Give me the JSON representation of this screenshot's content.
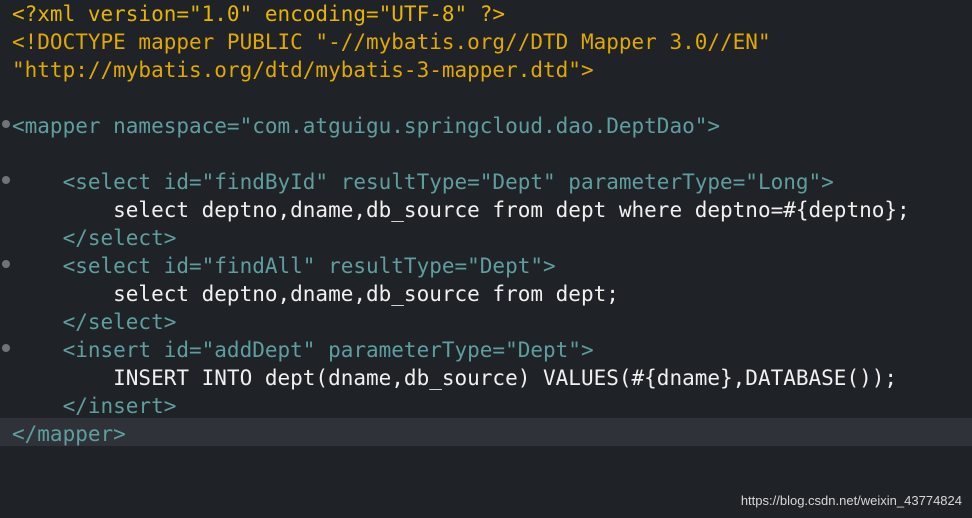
{
  "lines": [
    "<?xml version=\"1.0\" encoding=\"UTF-8\" ?>",
    "<!DOCTYPE mapper PUBLIC \"-//mybatis.org//DTD Mapper 3.0//EN\"",
    "\"http://mybatis.org/dtd/mybatis-3-mapper.dtd\">",
    "",
    "<mapper namespace=\"com.atguigu.springcloud.dao.DeptDao\">",
    "",
    "    <select id=\"findById\" resultType=\"Dept\" parameterType=\"Long\">",
    "        select deptno,dname,db_source from dept where deptno=#{deptno};",
    "    </select>",
    "    <select id=\"findAll\" resultType=\"Dept\">",
    "        select deptno,dname,db_source from dept;",
    "    </select>",
    "    <insert id=\"addDept\" parameterType=\"Dept\">",
    "        INSERT INTO dept(dname,db_source) VALUES(#{dname},DATABASE());",
    "    </insert>",
    "</mapper>"
  ],
  "watermark": "https://blog.csdn.net/weixin_43774824"
}
